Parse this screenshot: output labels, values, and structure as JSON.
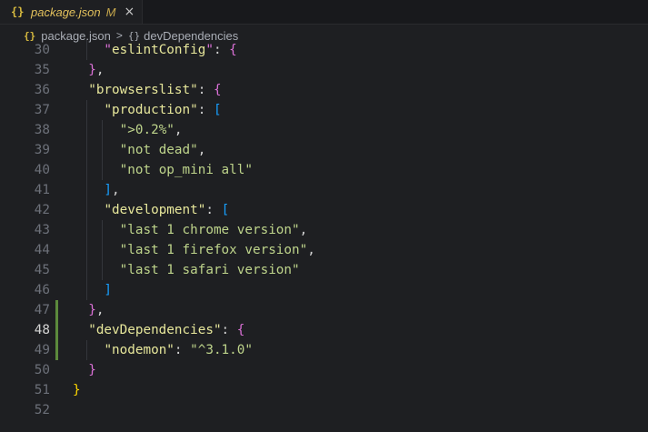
{
  "tab": {
    "icon": "{}",
    "filename": "package.json",
    "status": "M",
    "close": "×"
  },
  "breadcrumb": {
    "file_icon": "{}",
    "file": "package.json",
    "separator": ">",
    "node_icon": "{}",
    "node": "devDependencies"
  },
  "editor": {
    "active_line": 48,
    "lines": [
      {
        "num": "30",
        "tokens": [
          [
            "b2",
            "    \""
          ],
          [
            "kk",
            "eslintConfig"
          ],
          [
            "b2",
            "\""
          ],
          [
            "p",
            ": "
          ],
          [
            "b2",
            "{"
          ]
        ]
      },
      {
        "num": "35",
        "tokens": [
          [
            "b2",
            "  }"
          ],
          [
            "p",
            ","
          ]
        ]
      },
      {
        "num": "36",
        "tokens": [
          [
            "p",
            "  "
          ],
          [
            "kk",
            "\"browserslist\""
          ],
          [
            "p",
            ": "
          ],
          [
            "b2",
            "{"
          ]
        ]
      },
      {
        "num": "37",
        "tokens": [
          [
            "p",
            "    "
          ],
          [
            "kk",
            "\"production\""
          ],
          [
            "p",
            ": "
          ],
          [
            "b3",
            "["
          ]
        ]
      },
      {
        "num": "38",
        "tokens": [
          [
            "p",
            "      "
          ],
          [
            "s",
            "\">0.2%\""
          ],
          [
            "p",
            ","
          ]
        ]
      },
      {
        "num": "39",
        "tokens": [
          [
            "p",
            "      "
          ],
          [
            "s",
            "\"not dead\""
          ],
          [
            "p",
            ","
          ]
        ]
      },
      {
        "num": "40",
        "tokens": [
          [
            "p",
            "      "
          ],
          [
            "s",
            "\"not op_mini all\""
          ]
        ]
      },
      {
        "num": "41",
        "tokens": [
          [
            "b3",
            "    ]"
          ],
          [
            "p",
            ","
          ]
        ]
      },
      {
        "num": "42",
        "tokens": [
          [
            "p",
            "    "
          ],
          [
            "kk",
            "\"development\""
          ],
          [
            "p",
            ": "
          ],
          [
            "b3",
            "["
          ]
        ]
      },
      {
        "num": "43",
        "tokens": [
          [
            "p",
            "      "
          ],
          [
            "s",
            "\"last 1 chrome version\""
          ],
          [
            "p",
            ","
          ]
        ]
      },
      {
        "num": "44",
        "tokens": [
          [
            "p",
            "      "
          ],
          [
            "s",
            "\"last 1 firefox version\""
          ],
          [
            "p",
            ","
          ]
        ]
      },
      {
        "num": "45",
        "tokens": [
          [
            "p",
            "      "
          ],
          [
            "s",
            "\"last 1 safari version\""
          ]
        ]
      },
      {
        "num": "46",
        "tokens": [
          [
            "b3",
            "    ]"
          ]
        ]
      },
      {
        "num": "47",
        "tokens": [
          [
            "b2",
            "  }"
          ],
          [
            "p",
            ","
          ]
        ]
      },
      {
        "num": "48",
        "tokens": [
          [
            "p",
            "  "
          ],
          [
            "kk",
            "\"devDependencies\""
          ],
          [
            "p",
            ": "
          ],
          [
            "b2",
            "{"
          ]
        ]
      },
      {
        "num": "49",
        "tokens": [
          [
            "p",
            "    "
          ],
          [
            "kk",
            "\"nodemon\""
          ],
          [
            "p",
            ": "
          ],
          [
            "s",
            "\"^3.1.0\""
          ]
        ]
      },
      {
        "num": "50",
        "tokens": [
          [
            "b2",
            "  }"
          ]
        ]
      },
      {
        "num": "51",
        "tokens": [
          [
            "b1",
            "}"
          ]
        ]
      },
      {
        "num": "52",
        "tokens": []
      }
    ]
  }
}
